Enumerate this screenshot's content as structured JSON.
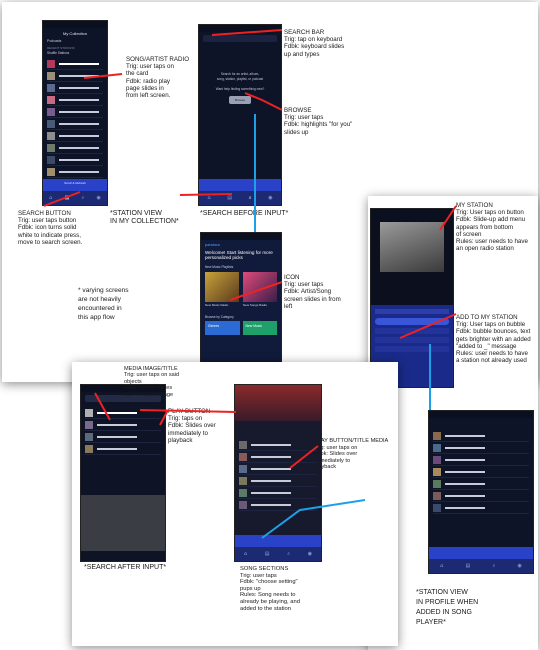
{
  "sheet1": {
    "phone_collection": {
      "title": "My Collection",
      "podcasts_label": "Podcasts",
      "section_label": "RECENT STATIONS",
      "shuffle_label": "Shuffle Stations",
      "bottom_strip": "Scroll & Refresh"
    },
    "phone_search": {
      "hint_line1": "Search for an artist, album,",
      "hint_line2": "song, station, playlist, or podcast",
      "browse_line": "Want help finding something new?",
      "browse_button": "Browse"
    },
    "phone_browse": {
      "brand": "pandora",
      "welcome": "Welcome! Start listening for more personalized picks",
      "new_music_label": "New Music Playlists",
      "card1_title": "New Music Radio",
      "card2_title": "New Songs Radio",
      "browse_by": "Browse by Category",
      "btn_genres": "Genres",
      "btn_new_music": "New Music"
    },
    "notes": {
      "song_artist_radio": [
        "SONG/ARTIST RADIO",
        "Trig: user taps on",
        "the card",
        "Fdbk: radio play",
        "page slides in",
        "from left screen."
      ],
      "search_bar": [
        "SEARCH BAR",
        "Trig: tap on keyboard",
        "Fdbk:  keyboard slides",
        "up and types"
      ],
      "browse": [
        "BROWSE",
        "Trig: user taps",
        "Fdbk: highlights \"for you\"",
        "slides up"
      ],
      "search_button": [
        "SEARCH BUTTON",
        "Trig: user taps button",
        "Fdbk: icon turns solid",
        "white to indicate press,",
        "move to search screen."
      ],
      "icon": [
        "ICON",
        "Trig: user taps",
        "Fdbk: Artist/Song",
        "screen slides in from",
        "left"
      ],
      "varying": [
        "* varying screens",
        "are not heavily",
        "encountered in",
        "this app flow"
      ]
    },
    "captions": {
      "station_view": [
        "*STATION VIEW",
        "IN MY COLLECTION*"
      ],
      "search_before": [
        "*SEARCH BEFORE INPUT*"
      ]
    }
  },
  "sheet2": {
    "notes": {
      "my_station": [
        "MY STATION",
        "Trig: User taps on button",
        "Fdbk: Slide-up add menu",
        "appears from bottom",
        "of screen",
        "Rules: user needs to have",
        "an open radio station"
      ],
      "add_to_my_station": [
        "ADD TO MY STATION",
        "Trig: User taps on bubble",
        "Fdbk: bubble bounces, text",
        "gets brighter with an added",
        "\"added to _\" message",
        "Rules: user needs to have",
        "a station not already used"
      ]
    },
    "caption": [
      "*STATION VIEW",
      "IN PROFILE WHEN",
      "ADDED IN SONG",
      "PLAYER*"
    ]
  },
  "sheet3": {
    "notes": {
      "media_image_title": [
        "MEDIA IMAGE/TITLE",
        "Trig: user taps on said",
        "objects",
        "Fdbk: screen slides",
        "over to station page"
      ],
      "play_button": [
        "PLAY BUTTON",
        "Trig: taps on",
        "Fdbk: Slides over",
        "immediately to",
        "playback"
      ],
      "play_button_title_media": [
        "PLAY BUTTON/TITLE MEDIA",
        "Trig: user taps on",
        "Fdbk: Slides over",
        "immediately to",
        "playback"
      ],
      "song_sections": [
        "SONG SECTIONS",
        "Trig: user taps",
        "Fdbk: \"choose setting\"",
        "pups up",
        "Rules: Song needs to",
        "already be playing, and",
        "added to the station"
      ]
    },
    "captions": {
      "search_after": "*SEARCH AFTER INPUT*"
    }
  }
}
